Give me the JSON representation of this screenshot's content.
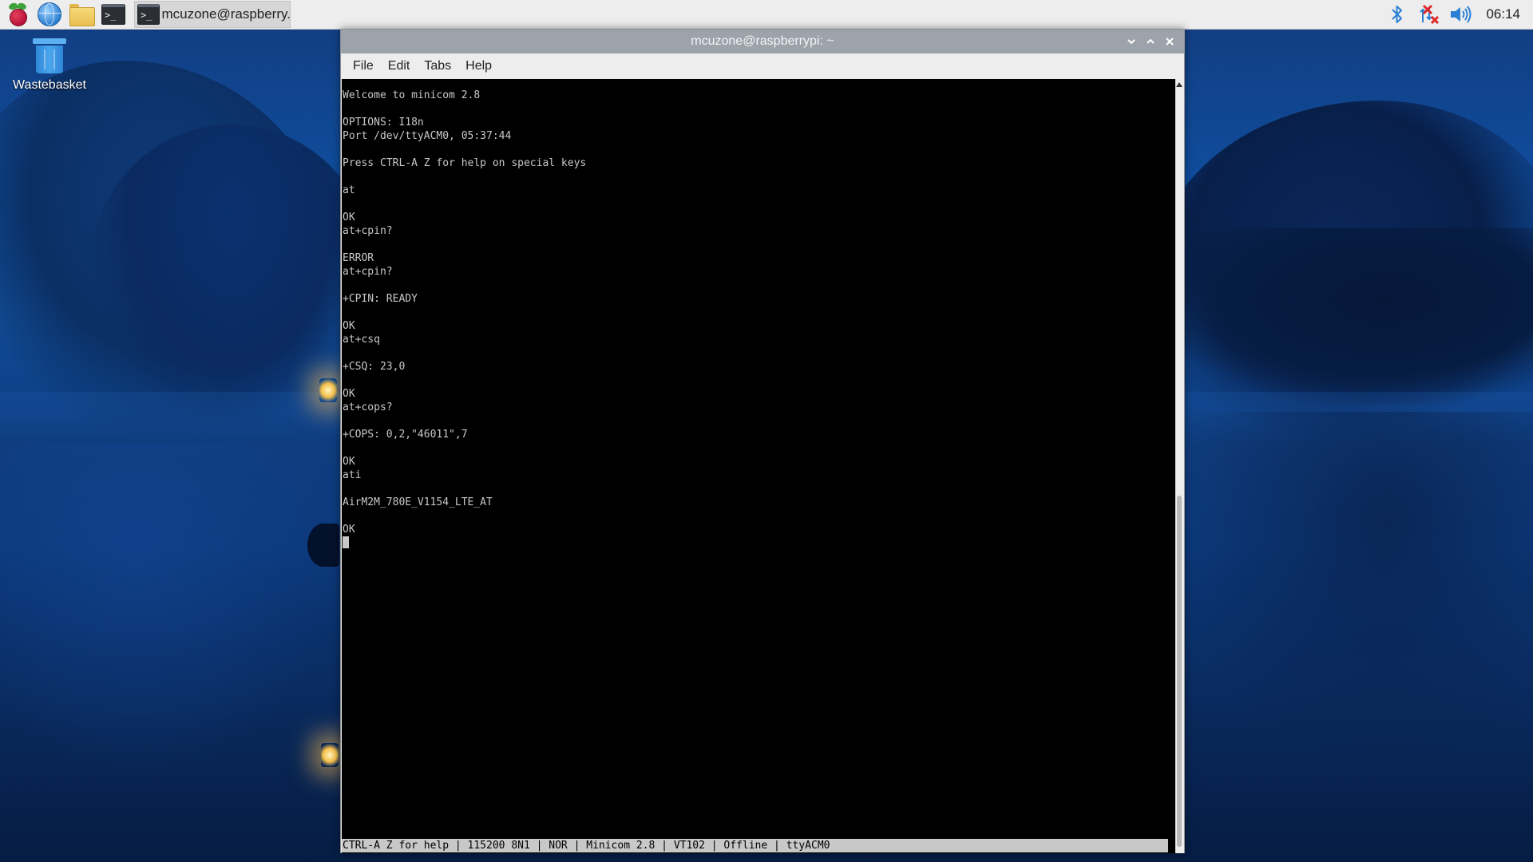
{
  "taskbar": {
    "launchers": [
      {
        "icon": "raspberry-pi-menu-icon"
      },
      {
        "icon": "web-browser-icon"
      },
      {
        "icon": "file-manager-icon"
      },
      {
        "icon": "terminal-icon"
      }
    ],
    "task": {
      "icon": "terminal-icon",
      "label": "mcuzone@raspberry..."
    },
    "tray": {
      "icons": [
        "bluetooth-icon",
        "network-disconnected-icon",
        "volume-icon"
      ],
      "clock": "06:14"
    }
  },
  "desktop": {
    "icons": [
      {
        "icon": "wastebasket-icon",
        "label": "Wastebasket"
      }
    ]
  },
  "window": {
    "title": "mcuzone@raspberrypi: ~",
    "controls": [
      "minimize-icon",
      "maximize-icon",
      "close-icon"
    ],
    "menu": [
      "File",
      "Edit",
      "Tabs",
      "Help"
    ],
    "terminal": {
      "lines": [
        "Welcome to minicom 2.8",
        "",
        "OPTIONS: I18n",
        "Port /dev/ttyACM0, 05:37:44",
        "",
        "Press CTRL-A Z for help on special keys",
        "",
        "at",
        "",
        "OK",
        "at+cpin?",
        "",
        "ERROR",
        "at+cpin?",
        "",
        "+CPIN: READY",
        "",
        "OK",
        "at+csq",
        "",
        "+CSQ: 23,0",
        "",
        "OK",
        "at+cops?",
        "",
        "+COPS: 0,2,\"46011\",7",
        "",
        "OK",
        "ati",
        "",
        "AirM2M_780E_V1154_LTE_AT",
        "",
        "OK"
      ],
      "status_line": "CTRL-A Z for help | 115200 8N1 | NOR | Minicom 2.8 | VT102 | Offline | ttyACM0"
    }
  },
  "colors": {
    "taskbar_bg": "#ededed",
    "titlebar_bg": "#9da3aa",
    "terminal_bg": "#000000",
    "terminal_fg": "#c8c8c8",
    "statusbar_bg": "#c8c8c8",
    "desktop_bg": "#0f4c9c"
  }
}
